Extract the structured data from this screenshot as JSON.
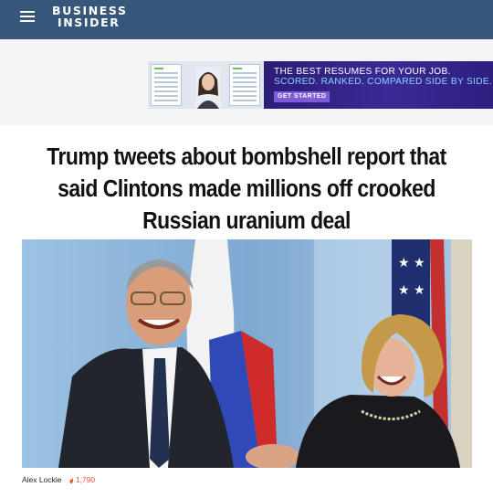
{
  "header": {
    "logo_line1": "BUSINESS",
    "logo_line2": "INSIDER",
    "menu_icon": "hamburger-menu-icon",
    "bg_color": "#36577a"
  },
  "ad": {
    "line1": "THE BEST RESUMES FOR YOUR JOB.",
    "line2": "SCORED. RANKED. COMPARED SIDE BY SIDE.",
    "cta": "GET STARTED",
    "accent": "#2b1d77"
  },
  "article": {
    "headline": "Trump tweets about bombshell report that said Clintons made millions off crooked Russian uranium deal",
    "author": "Alex Lockie",
    "views": "1,790",
    "views_icon": "flame-icon",
    "views_color": "#e45a2a"
  }
}
